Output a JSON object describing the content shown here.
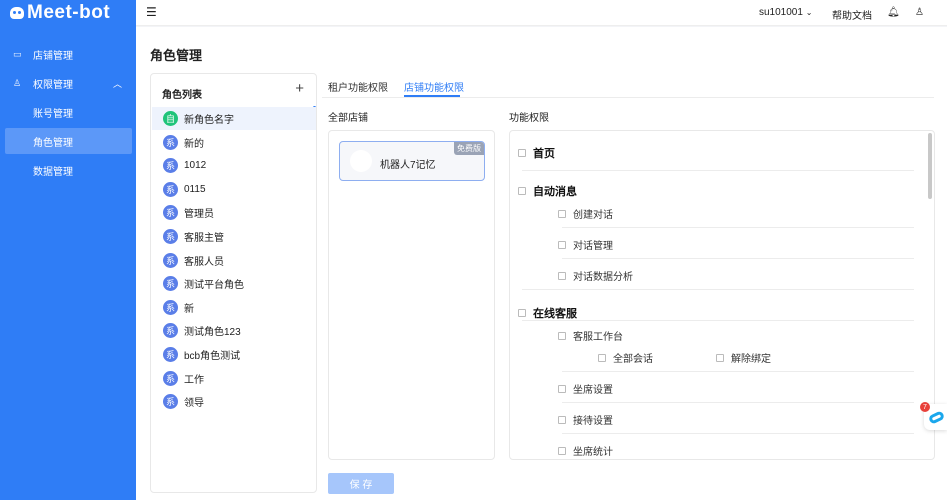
{
  "brand": {
    "name": "Meet-bot"
  },
  "sidebar": {
    "items": [
      {
        "label": "店铺管理",
        "icon": "store-icon"
      },
      {
        "label": "权限管理",
        "icon": "user-icon",
        "expanded": true
      },
      {
        "label": "账号管理"
      },
      {
        "label": "角色管理",
        "active": true
      },
      {
        "label": "数据管理"
      }
    ]
  },
  "header": {
    "user": "su101001",
    "help": "帮助文档"
  },
  "page": {
    "title": "角色管理"
  },
  "roles": {
    "title": "角色列表",
    "add": "+",
    "items": [
      {
        "badge": "自",
        "name": "新角色名字",
        "selected": true
      },
      {
        "badge": "系",
        "name": "新的"
      },
      {
        "badge": "系",
        "name": "1012"
      },
      {
        "badge": "系",
        "name": "0115"
      },
      {
        "badge": "系",
        "name": "管理员"
      },
      {
        "badge": "系",
        "name": "客服主管"
      },
      {
        "badge": "系",
        "name": "客服人员"
      },
      {
        "badge": "系",
        "name": "测试平台角色"
      },
      {
        "badge": "系",
        "name": "新"
      },
      {
        "badge": "系",
        "name": "测试角色123"
      },
      {
        "badge": "系",
        "name": "bcb角色测试"
      },
      {
        "badge": "系",
        "name": "工作"
      },
      {
        "badge": "系",
        "name": "领导"
      }
    ]
  },
  "tabs": [
    {
      "label": "租户功能权限"
    },
    {
      "label": "店铺功能权限",
      "active": true
    }
  ],
  "stores": {
    "title": "全部店铺",
    "items": [
      {
        "name": "机器人7记忆",
        "tag": "免费版"
      }
    ]
  },
  "permissions": {
    "title": "功能权限",
    "items": [
      {
        "label": "首页",
        "level": 1
      },
      {
        "label": "自动消息",
        "level": 1
      },
      {
        "label": "创建对话",
        "level": 2
      },
      {
        "label": "对话管理",
        "level": 2
      },
      {
        "label": "对话数据分析",
        "level": 2
      },
      {
        "label": "在线客服",
        "level": 1
      },
      {
        "label": "客服工作台",
        "level": 2
      },
      {
        "label": "全部会话",
        "level": 3
      },
      {
        "label": "解除绑定",
        "level": 3
      },
      {
        "label": "坐席设置",
        "level": 2
      },
      {
        "label": "接待设置",
        "level": 2
      },
      {
        "label": "坐席统计",
        "level": 2
      }
    ]
  },
  "save": "保 存",
  "float": {
    "count": "7"
  },
  "colors": {
    "primary": "#2f7df6",
    "green": "#20c47a",
    "badge": "#5a7ee8"
  }
}
